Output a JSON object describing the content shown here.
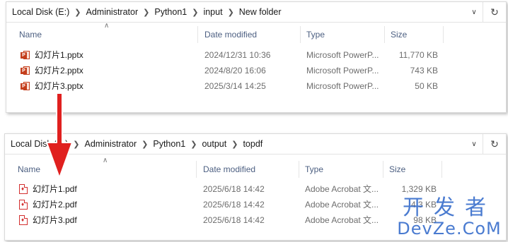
{
  "top_window": {
    "breadcrumb": [
      "Local Disk (E:)",
      "Administrator",
      "Python1",
      "input",
      "New folder"
    ],
    "columns": {
      "name": "Name",
      "date": "Date modified",
      "type": "Type",
      "size": "Size"
    },
    "files": [
      {
        "name": "幻灯片1.pptx",
        "date": "2024/12/31 10:36",
        "type": "Microsoft PowerP...",
        "size": "11,770 KB",
        "icon": "powerpoint-file-icon"
      },
      {
        "name": "幻灯片2.pptx",
        "date": "2024/8/20 16:06",
        "type": "Microsoft PowerP...",
        "size": "743 KB",
        "icon": "powerpoint-file-icon"
      },
      {
        "name": "幻灯片3.pptx",
        "date": "2025/3/14 14:25",
        "type": "Microsoft PowerP...",
        "size": "50 KB",
        "icon": "powerpoint-file-icon"
      }
    ]
  },
  "bottom_window": {
    "breadcrumb": [
      "Local Disk (E:)",
      "Administrator",
      "Python1",
      "output",
      "topdf"
    ],
    "columns": {
      "name": "Name",
      "date": "Date modified",
      "type": "Type",
      "size": "Size"
    },
    "files": [
      {
        "name": "幻灯片1.pdf",
        "date": "2025/6/18 14:42",
        "type": "Adobe Acrobat 文...",
        "size": "1,329 KB",
        "icon": "pdf-file-icon"
      },
      {
        "name": "幻灯片2.pdf",
        "date": "2025/6/18 14:42",
        "type": "Adobe Acrobat 文...",
        "size": "4 3 KB",
        "icon": "pdf-file-icon"
      },
      {
        "name": "幻灯片3.pdf",
        "date": "2025/6/18 14:42",
        "type": "Adobe Acrobat 文...",
        "size": "98 KB",
        "icon": "pdf-file-icon"
      }
    ]
  },
  "watermark": {
    "cn": "开发者",
    "en": "DevZe.CoM"
  },
  "colors": {
    "arrow": "#e0201f",
    "header_text": "#4d6082",
    "watermark": "#2b64c8"
  }
}
